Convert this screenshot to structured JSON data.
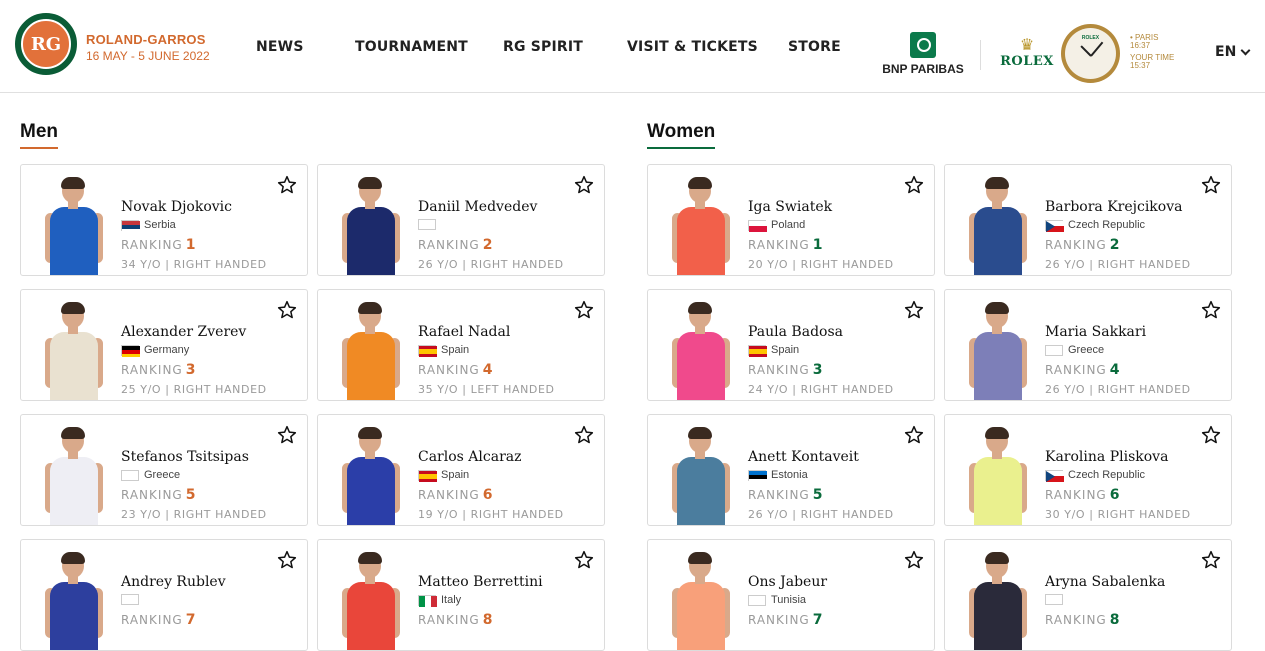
{
  "header": {
    "brand_title": "ROLAND-GARROS",
    "brand_dates": "16 MAY - 5 JUNE 2022",
    "logo_letters": "RG",
    "nav": [
      "NEWS",
      "TOURNAMENT",
      "RG SPIRIT",
      "VISIT & TICKETS",
      "STORE"
    ],
    "sponsor_bnp": "BNP PARIBAS",
    "sponsor_rolex": "ROLEX",
    "clock_brand": "ROLEX",
    "paris_label": "• PARIS",
    "paris_time": "16:37",
    "your_time_label": "YOUR TIME",
    "your_time": "15:37",
    "language": "EN"
  },
  "colors": {
    "accent_men": "#d2692e",
    "accent_women": "#0a6b3c"
  },
  "sections": {
    "men_title": "Men",
    "women_title": "Women",
    "ranking_label": "RANKING"
  },
  "men": [
    {
      "name": "Novak Djokovic",
      "country": "Serbia",
      "flag": "serbia",
      "ranking": "1",
      "info": "34 Y/O | RIGHT HANDED",
      "shirt": "#1f5fbf"
    },
    {
      "name": "Daniil Medvedev",
      "country": "",
      "flag": "blank",
      "ranking": "2",
      "info": "26 Y/O | RIGHT HANDED",
      "shirt": "#1c2a6b"
    },
    {
      "name": "Alexander Zverev",
      "country": "Germany",
      "flag": "germany",
      "ranking": "3",
      "info": "25 Y/O | RIGHT HANDED",
      "shirt": "#e9e1d0"
    },
    {
      "name": "Rafael Nadal",
      "country": "Spain",
      "flag": "spain",
      "ranking": "4",
      "info": "35 Y/O | LEFT HANDED",
      "shirt": "#f08a24"
    },
    {
      "name": "Stefanos Tsitsipas",
      "country": "Greece",
      "flag": "blank",
      "ranking": "5",
      "info": "23 Y/O | RIGHT HANDED",
      "shirt": "#eeeef4"
    },
    {
      "name": "Carlos Alcaraz",
      "country": "Spain",
      "flag": "spain",
      "ranking": "6",
      "info": "19 Y/O | RIGHT HANDED",
      "shirt": "#2b3ea8"
    },
    {
      "name": "Andrey Rublev",
      "country": "",
      "flag": "blank",
      "ranking": "7",
      "info": "",
      "shirt": "#2d3f9e"
    },
    {
      "name": "Matteo Berrettini",
      "country": "Italy",
      "flag": "italy",
      "ranking": "8",
      "info": "",
      "shirt": "#e9463a"
    }
  ],
  "women": [
    {
      "name": "Iga Swiatek",
      "country": "Poland",
      "flag": "poland",
      "ranking": "1",
      "info": "20 Y/O | RIGHT HANDED",
      "shirt": "#f2604a"
    },
    {
      "name": "Barbora Krejcikova",
      "country": "Czech Republic",
      "flag": "czech",
      "ranking": "2",
      "info": "26 Y/O | RIGHT HANDED",
      "shirt": "#2a4c8e"
    },
    {
      "name": "Paula Badosa",
      "country": "Spain",
      "flag": "spain",
      "ranking": "3",
      "info": "24 Y/O | RIGHT HANDED",
      "shirt": "#f04a8c"
    },
    {
      "name": "Maria Sakkari",
      "country": "Greece",
      "flag": "blank",
      "ranking": "4",
      "info": "26 Y/O | RIGHT HANDED",
      "shirt": "#7d7fb8"
    },
    {
      "name": "Anett Kontaveit",
      "country": "Estonia",
      "flag": "estonia",
      "ranking": "5",
      "info": "26 Y/O | RIGHT HANDED",
      "shirt": "#4b7d9e"
    },
    {
      "name": "Karolina Pliskova",
      "country": "Czech Republic",
      "flag": "czech",
      "ranking": "6",
      "info": "30 Y/O | RIGHT HANDED",
      "shirt": "#eaf08e"
    },
    {
      "name": "Ons Jabeur",
      "country": "Tunisia",
      "flag": "blank",
      "ranking": "7",
      "info": "",
      "shirt": "#f8a07a"
    },
    {
      "name": "Aryna Sabalenka",
      "country": "",
      "flag": "blank",
      "ranking": "8",
      "info": "",
      "shirt": "#2a2a3a"
    }
  ]
}
